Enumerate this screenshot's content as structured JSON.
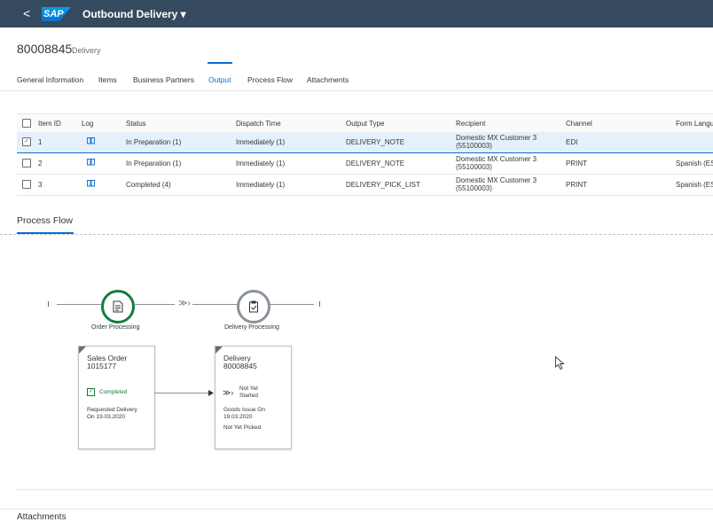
{
  "shell": {
    "back_glyph": "<",
    "logo_text": "SAP",
    "app_title": "Outbound Delivery ▾"
  },
  "header": {
    "object_id": "80008845",
    "object_type": "Delivery"
  },
  "tabs": [
    {
      "label": "General Information"
    },
    {
      "label": "Items"
    },
    {
      "label": "Business Partners"
    },
    {
      "label": "Output"
    },
    {
      "label": "Process Flow"
    },
    {
      "label": "Attachments"
    }
  ],
  "output_table": {
    "columns": [
      "Item ID",
      "Log",
      "Status",
      "Dispatch Time",
      "Output Type",
      "Recipient",
      "Channel",
      "Form Langu"
    ],
    "rows": [
      {
        "selected": true,
        "item_id": "1",
        "status": "In Preparation (1)",
        "dispatch": "Immediately (1)",
        "output_type": "DELIVERY_NOTE",
        "recipient_1": "Domestic MX Customer 3",
        "recipient_2": "(55100003)",
        "channel": "EDI",
        "lang": ""
      },
      {
        "selected": false,
        "item_id": "2",
        "status": "In Preparation (1)",
        "dispatch": "Immediately (1)",
        "output_type": "DELIVERY_NOTE",
        "recipient_1": "Domestic MX Customer 3",
        "recipient_2": "(55100003)",
        "channel": "PRINT",
        "lang": "Spanish (ES"
      },
      {
        "selected": false,
        "item_id": "3",
        "status": "Completed (4)",
        "dispatch": "Immediately (1)",
        "output_type": "DELIVERY_PICK_LIST",
        "recipient_1": "Domestic MX Customer 3",
        "recipient_2": "(55100003)",
        "channel": "PRINT",
        "lang": "Spanish (ES"
      }
    ],
    "check_glyph": "✓"
  },
  "process_flow": {
    "title": "Process Flow",
    "lanes": [
      {
        "label": "Order Processing",
        "color": "#107e3e"
      },
      {
        "label": "Delivery Processing",
        "color": "#89919a"
      }
    ],
    "connector_glyph": "≫›",
    "cards": [
      {
        "title_1": "Sales Order",
        "title_2": "1015177",
        "status": "Completed",
        "status_color": "#107e3e",
        "detail_1": "Requested Delivery",
        "detail_2": "On 19.03.2020",
        "detail_3": ""
      },
      {
        "title_1": "Delivery",
        "title_2": "80008845",
        "status_1": "Not Yet",
        "status_2": "Started",
        "detail_1": "Goods Issue On",
        "detail_2": "19.03.2020",
        "detail_3": "Not Yet Picked"
      }
    ]
  },
  "attachments": {
    "title": "Attachments"
  }
}
